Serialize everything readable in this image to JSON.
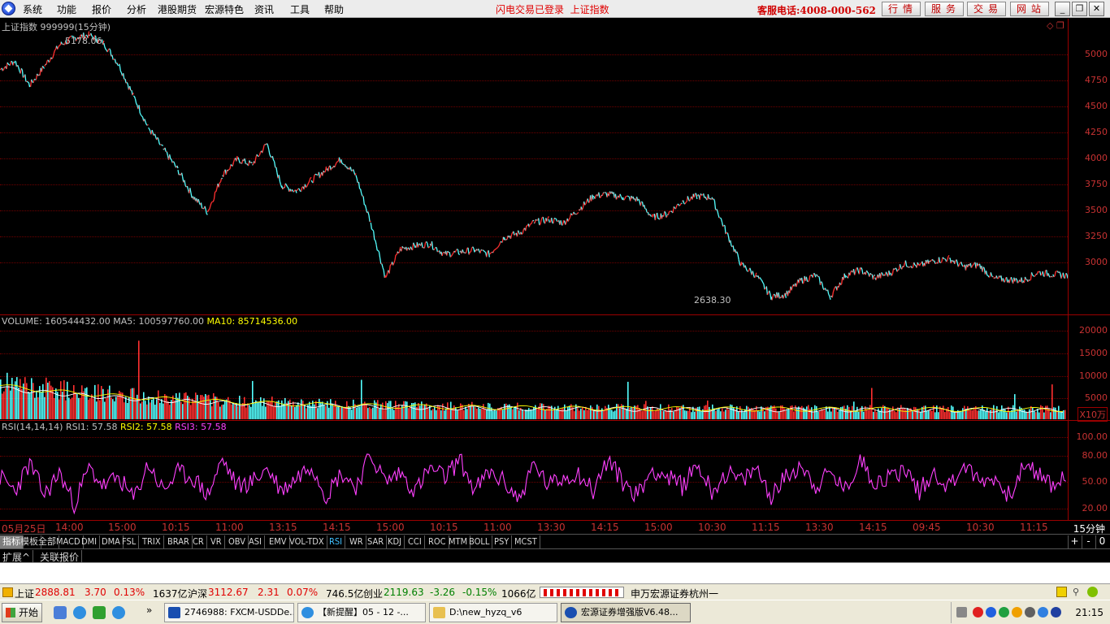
{
  "menu": {
    "items": [
      "系统",
      "功能",
      "报价",
      "分析",
      "港股期货",
      "宏源特色",
      "资讯",
      "工具",
      "帮助"
    ],
    "status": "闪电交易已登录  上证指数",
    "hotline": "客服电话:4008-000-562",
    "service_buttons": [
      "行情",
      "服务",
      "交易",
      "网站"
    ],
    "window_buttons": [
      "minimize",
      "restore",
      "close"
    ]
  },
  "main_chart": {
    "title": "上证指数 999999(15分钟)",
    "high_label": "5178.06",
    "low_label": "2638.30",
    "price_ticks": [
      "5000",
      "4750",
      "4500",
      "4250",
      "4000",
      "3750",
      "3500",
      "3250",
      "3000"
    ],
    "line_color": "#54ffff",
    "down_color": "#ff3030"
  },
  "volume_panel": {
    "title": "VOLUME: 160544432.00",
    "ma5": "MA5: 100597760.00",
    "ma10": "MA10: 85714536.00",
    "ticks": [
      "20000",
      "15000",
      "10000",
      "5000"
    ],
    "unit": "X10万"
  },
  "rsi_panel": {
    "title": "RSI(14,14,14)",
    "rsi1": "RSI1: 57.58",
    "rsi2": "RSI2: 57.58",
    "rsi3": "RSI3: 57.58",
    "ticks": [
      "100.00",
      "80.00",
      "50.00",
      "20.00"
    ]
  },
  "chart_data": {
    "type": "line",
    "title": "上证指数 999999(15分钟)",
    "price_range": [
      2638.3,
      5178.06
    ],
    "series": [
      {
        "name": "上证指数",
        "values": [
          4850,
          4930,
          4700,
          4880,
          5080,
          5150,
          5178,
          5100,
          4900,
          4600,
          4300,
          4100,
          3900,
          3650,
          3500,
          3850,
          4000,
          3950,
          4150,
          3750,
          3700,
          3800,
          3900,
          4000,
          3850,
          3400,
          2880,
          3150,
          3180,
          3200,
          3100,
          3120,
          3140,
          3100,
          3260,
          3300,
          3400,
          3430,
          3400,
          3520,
          3650,
          3670,
          3640,
          3620,
          3450,
          3480,
          3600,
          3650,
          3640,
          3300,
          3000,
          2900,
          2700,
          2720,
          2850,
          2900,
          2700,
          2900,
          2950,
          2880,
          2920,
          3010,
          2990,
          3040,
          3060,
          2980,
          3000,
          2870,
          2860,
          2850,
          2930,
          2910,
          2900
        ]
      },
      {
        "name": "RSI1",
        "values": [
          55,
          40,
          70,
          35,
          60,
          25,
          65,
          45,
          55,
          30,
          70,
          40,
          60,
          55,
          35,
          75,
          45,
          50,
          65,
          40,
          55,
          70,
          35,
          60,
          45,
          80,
          50,
          60,
          40,
          65,
          55,
          75,
          40,
          60,
          50,
          30,
          70,
          45,
          55,
          60,
          40,
          75,
          50,
          35,
          65,
          55,
          45,
          70,
          40,
          60,
          50,
          65,
          35,
          55,
          70,
          45,
          60,
          40,
          75,
          50,
          55,
          65,
          40,
          60,
          45,
          70,
          50,
          55,
          35,
          65,
          60,
          45,
          58
        ]
      }
    ],
    "volume_ticks": [
      20000,
      15000,
      10000,
      5000
    ],
    "rsi_ticks": [
      100,
      80,
      50,
      20
    ]
  },
  "time_axis": {
    "labels": [
      "05月25日",
      "14:00",
      "15:00",
      "10:15",
      "11:00",
      "13:15",
      "14:15",
      "15:00",
      "10:15",
      "11:00",
      "13:30",
      "14:15",
      "15:00",
      "10:30",
      "11:15",
      "13:30",
      "14:15",
      "09:45",
      "10:30",
      "11:15"
    ],
    "period": "15分钟"
  },
  "indicator_tabs": [
    "指标",
    "模板",
    "全部",
    "MACD",
    "DMI",
    "DMA",
    "FSL",
    "TRIX",
    "BRAR",
    "CR",
    "VR",
    "OBV",
    "ASI",
    "EMV",
    "VOL-TDX",
    "RSI",
    "WR",
    "SAR",
    "KDJ",
    "CCI",
    "ROC",
    "MTM",
    "BOLL",
    "PSY",
    "MCST"
  ],
  "tab_controls": [
    "+",
    "-",
    "0"
  ],
  "ext_tabs": [
    "扩展^",
    "关联报价"
  ],
  "ticker": {
    "sh_name": "上证",
    "sh_value": "2888.81",
    "sh_change": "3.70",
    "sh_pct": "0.13%",
    "sh_amount": "1637亿",
    "hs_name": "沪深",
    "hs_value": "3112.67",
    "hs_change": "2.31",
    "hs_pct": "0.07%",
    "hs_amount": "746.5亿",
    "cy_name": "创业",
    "cy_value": "2119.63",
    "cy_change": "-3.26",
    "cy_pct": "-0.15%",
    "cy_amount": "1066亿",
    "broker": "申万宏源证券杭州一"
  },
  "taskbar": {
    "start": "开始",
    "tasks": [
      "2746988: FXCM-USDDe...",
      "【新提醒】05 - 12 -...",
      "D:\\new_hyzq_v6",
      "宏源证券增强版V6.48..."
    ],
    "clock": "21:15"
  }
}
